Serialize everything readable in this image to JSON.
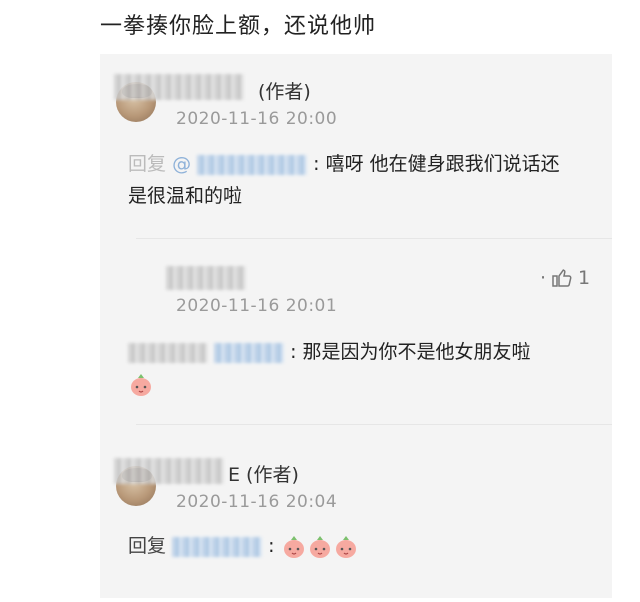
{
  "headline": "一拳揍你脸上额，还说他帅",
  "comments": [
    {
      "author_tag": "(作者)",
      "time": "2020-11-16 20:00",
      "reply_prefix": "回复",
      "mention_symbol": "@",
      "separator": ":",
      "text_line1": "嘻呀 他在健身跟我们说话还",
      "text_line2": "是很温和的啦"
    },
    {
      "time": "2020-11-16 20:01",
      "like_prefix": "·",
      "like_count": "1",
      "separator": ":",
      "text": "那是因为你不是他女朋友啦",
      "emoji": "peach-face-icon"
    },
    {
      "author_tag_partial": "E (作者)",
      "time": "2020-11-16 20:04",
      "reply_prefix": "回复",
      "separator": ":",
      "emoji_count": 3,
      "emoji": "peach-face-icon"
    }
  ],
  "colors": {
    "panel_bg": "#f4f4f4",
    "time_text": "#9a9a9a",
    "mention": "#8fb2d9"
  }
}
